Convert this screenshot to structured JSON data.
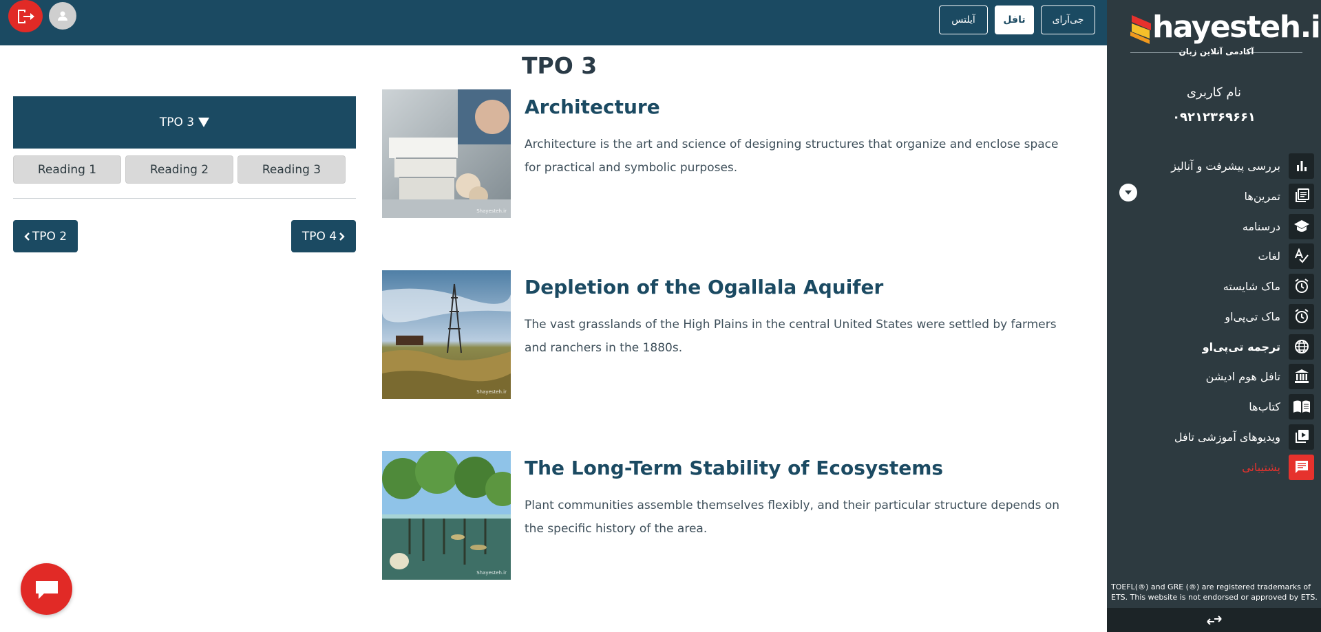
{
  "topbar": {
    "tabs": [
      {
        "label": "جی‌آرای"
      },
      {
        "label": "تافل",
        "active": true
      },
      {
        "label": "آیلتس"
      }
    ],
    "logout_icon": "logout-icon",
    "avatar_icon": "user-icon"
  },
  "sidebar": {
    "logo_text": "hayesteh.ir",
    "logo_subtitle": "آکادمی آنلاین زبان",
    "user_label": "نام کاربری",
    "user_phone": "۰۹۲۱۲۳۶۹۶۶۱",
    "menu": [
      {
        "label": "بررسی پیشرفت و آنالیز",
        "icon": "bar-chart-icon"
      },
      {
        "label": "تمرین‌ها",
        "icon": "library-books-icon"
      },
      {
        "label": "درسنامه",
        "icon": "graduation-cap-icon"
      },
      {
        "label": "لغات",
        "icon": "spellcheck-icon"
      },
      {
        "label": "ماک شایسته",
        "icon": "alarm-clock-icon"
      },
      {
        "label": "ماک تی‌پی‌او",
        "icon": "alarm-clock-icon"
      },
      {
        "label": "ترجمه تی‌پی‌او",
        "icon": "globe-icon"
      },
      {
        "label": "تافل هوم ادیشن",
        "icon": "institution-icon"
      },
      {
        "label": "کتاب‌ها",
        "icon": "open-book-icon"
      },
      {
        "label": "ویدیوهای آموزشی تافل",
        "icon": "video-library-icon"
      },
      {
        "label": "پشتیبانی",
        "icon": "chat-icon"
      }
    ],
    "disclaimer": "TOEFL(®) and GRE (®) are registered trademarks of ETS. This website is not endorsed or approved by ETS."
  },
  "left_panel": {
    "dropdown_label": "TPO 3",
    "readings": [
      "Reading 1",
      "Reading 2",
      "Reading 3"
    ],
    "prev_label": "TPO 2",
    "next_label": "TPO 4"
  },
  "main": {
    "title": "TPO 3",
    "cards": [
      {
        "title": "Architecture",
        "description": "Architecture is the art and science of designing structures that organize and enclose space for practical and symbolic purposes.",
        "image": "architecture-model-photo",
        "watermark": "Shayesteh.ir"
      },
      {
        "title": "Depletion of the Ogallala Aquifer",
        "description": "The vast grasslands of the High Plains in the central United States were settled by farmers and ranchers in the 1880s.",
        "image": "windmill-grassland-photo",
        "watermark": "Shayesteh.ir"
      },
      {
        "title": "The Long-Term Stability of Ecosystems",
        "description": "Plant communities assemble themselves flexibly, and their particular structure depends on the specific history of the area.",
        "image": "mangrove-jellyfish-photo",
        "watermark": "Shayesteh.ir"
      }
    ]
  },
  "colors": {
    "primary": "#1b4a62",
    "sidebar": "#2d3a40",
    "accent_red": "#e12a26"
  }
}
